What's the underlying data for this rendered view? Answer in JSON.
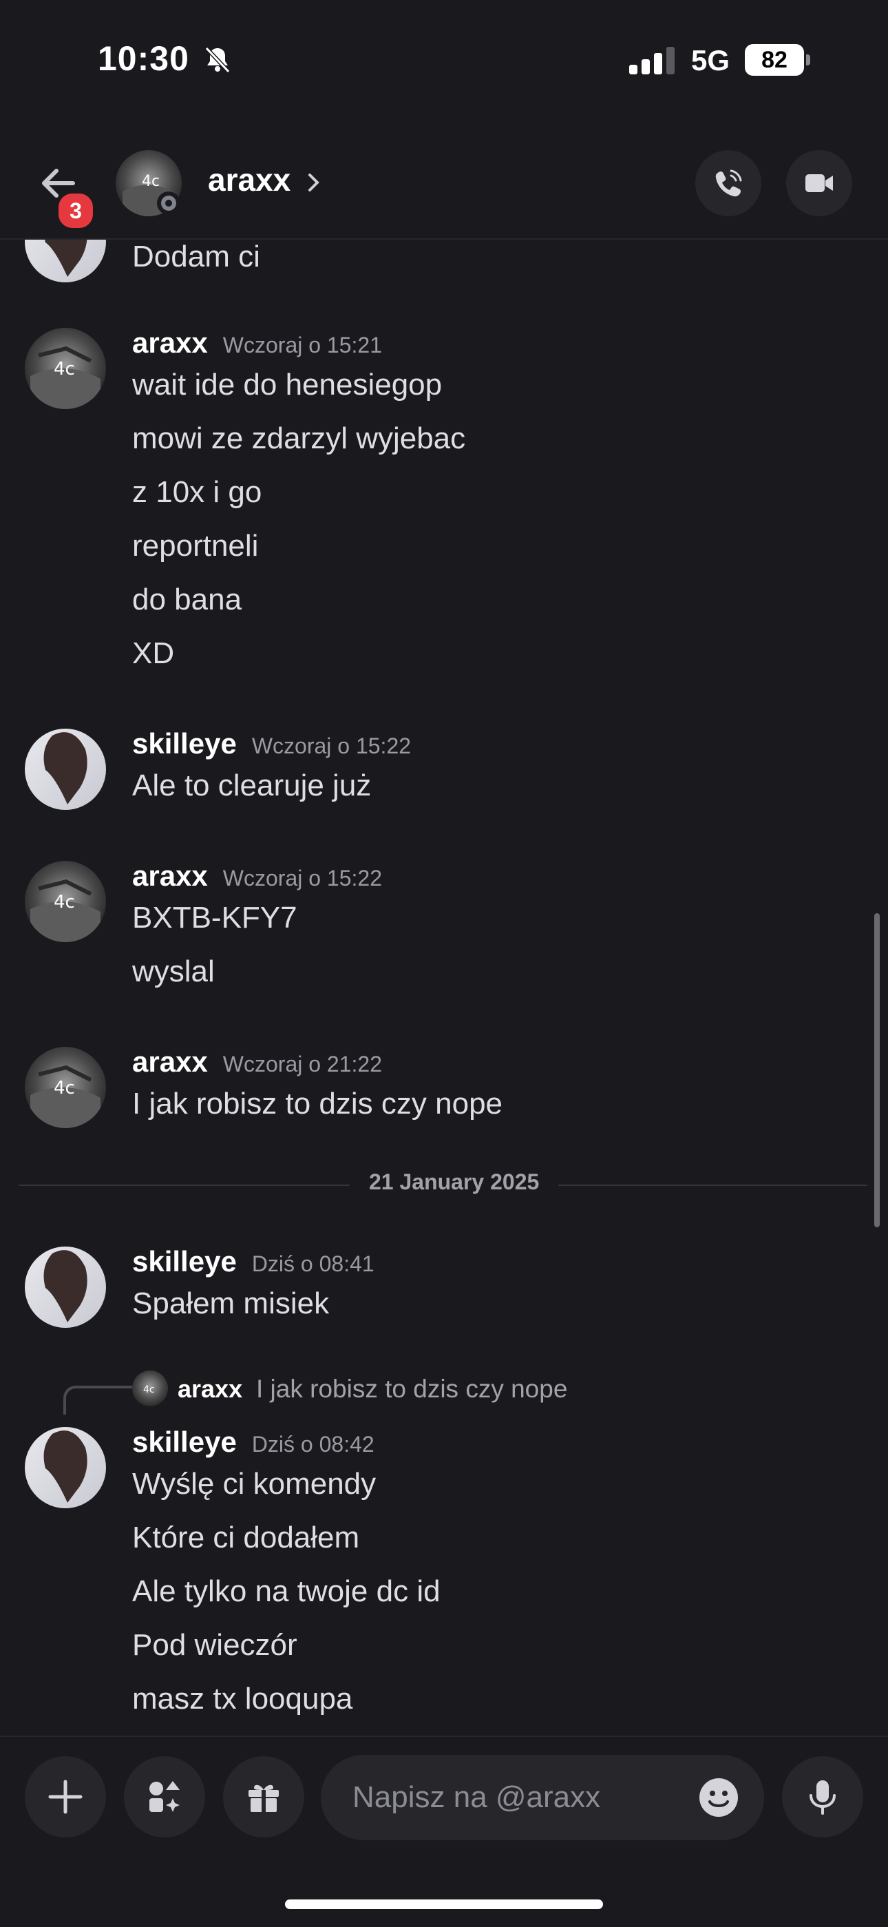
{
  "status_bar": {
    "time": "10:30",
    "network": "5G",
    "battery": "82"
  },
  "header": {
    "back_badge": "3",
    "name": "araxx"
  },
  "divider_date": "21 January 2025",
  "messages": [
    {
      "lines": [
        "Dodam ci"
      ]
    },
    {
      "author": "araxx",
      "timestamp": "Wczoraj o 15:21",
      "lines": [
        "wait ide do henesiegop",
        "mowi ze zdarzyl wyjebac",
        "z 10x i go",
        "reportneli",
        "do bana",
        "XD"
      ]
    },
    {
      "author": "skilleye",
      "timestamp": "Wczoraj o 15:22",
      "lines": [
        "Ale to clearuje już"
      ]
    },
    {
      "author": "araxx",
      "timestamp": "Wczoraj o 15:22",
      "lines": [
        "BXTB-KFY7",
        "wyslal"
      ]
    },
    {
      "author": "araxx",
      "timestamp": "Wczoraj o 21:22",
      "lines": [
        "I jak robisz to dzis czy nope"
      ]
    },
    {
      "author": "skilleye",
      "timestamp": "Dziś o 08:41",
      "lines": [
        "Spałem misiek"
      ]
    },
    {
      "reply_to": {
        "author": "araxx",
        "text": "I jak robisz to dzis czy nope"
      },
      "author": "skilleye",
      "timestamp": "Dziś o 08:42",
      "lines": [
        "Wyślę ci komendy",
        "Które ci dodałem",
        "Ale tylko na twoje dc id",
        "Pod wieczór",
        "masz tx looqupa"
      ]
    }
  ],
  "composer": {
    "placeholder": "Napisz na @araxx"
  },
  "colors": {
    "background": "#1a1a1e",
    "surface": "#26262b",
    "badge": "#e5383f",
    "text": "#dedee3",
    "muted": "#9a9aa3"
  }
}
